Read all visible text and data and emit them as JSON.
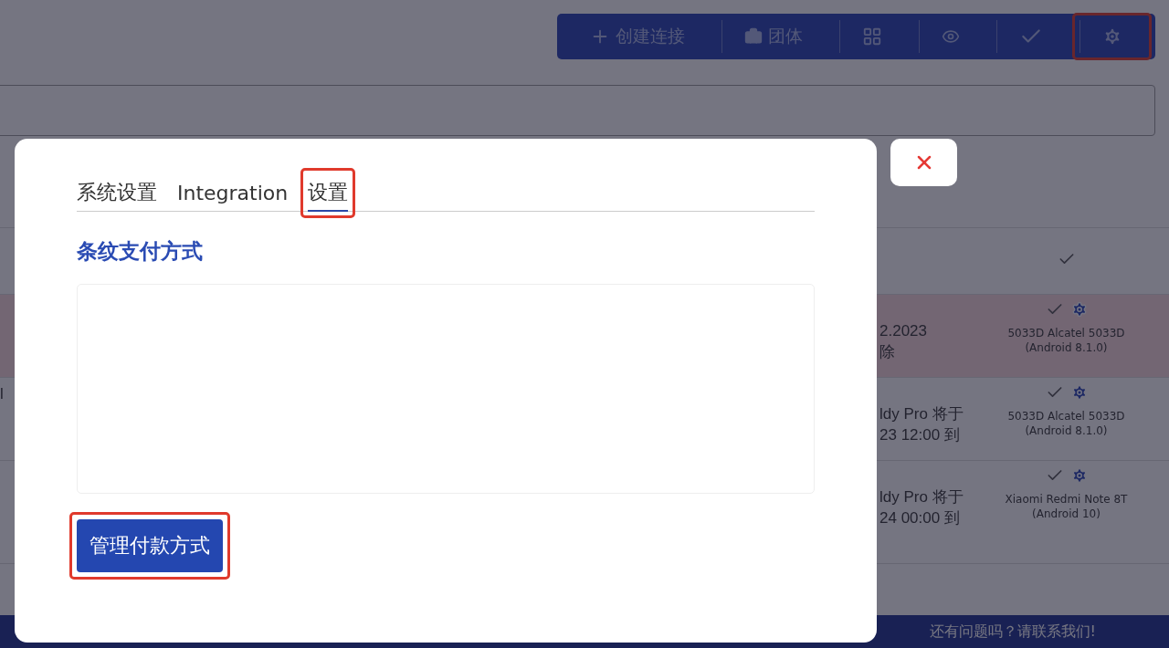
{
  "toolbar": [
    {
      "kind": "create",
      "label": "创建连接",
      "highlighted": false
    },
    {
      "kind": "group",
      "label": "团体",
      "highlighted": false
    },
    {
      "kind": "grid",
      "highlighted": false
    },
    {
      "kind": "view",
      "highlighted": false
    },
    {
      "kind": "confirm",
      "highlighted": false
    },
    {
      "kind": "settings",
      "highlighted": true
    }
  ],
  "table": {
    "rows": [
      {
        "flagged": false,
        "column_1": "",
        "column_2": [],
        "device": "",
        "settings_icon": false
      },
      {
        "flagged": true,
        "column_1": "",
        "column_2": [
          "2.2023",
          "除"
        ],
        "device": "5033D Alcatel 5033D (Android 8.1.0)",
        "settings_icon": true
      },
      {
        "flagged": false,
        "column_1": "l",
        "column_2": [
          "ldy Pro 将于",
          "23 12:00 到"
        ],
        "device": "5033D Alcatel 5033D (Android 8.1.0)",
        "settings_icon": true
      },
      {
        "flagged": false,
        "column_1": "",
        "column_2": [
          "ldy Pro 将于",
          "24 00:00 到"
        ],
        "device": "Xiaomi Redmi Note 8T (Android 10)",
        "settings_icon": true
      }
    ]
  },
  "footer": {
    "text": "还有问题吗？请联系我们!"
  },
  "dialog": {
    "tabs": [
      {
        "label": "系统设置",
        "selected": false,
        "highlighted": false
      },
      {
        "label": "Integration",
        "selected": false,
        "highlighted": false
      },
      {
        "label": "设置",
        "selected": true,
        "highlighted": true
      }
    ],
    "heading": "条纹支付方式",
    "button": {
      "label": "管理付款方式",
      "highlighted": true
    }
  }
}
